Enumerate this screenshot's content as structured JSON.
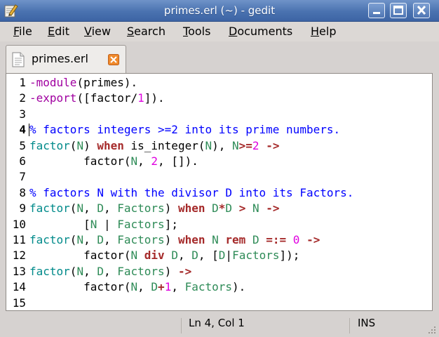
{
  "window": {
    "title": "primes.erl (~) - gedit",
    "app_icon": "gedit-pencil-icon",
    "buttons": [
      "minimize-icon",
      "maximize-icon",
      "close-icon"
    ]
  },
  "menubar": {
    "items": [
      {
        "label": "File",
        "mnemonic": "F",
        "rest": "ile"
      },
      {
        "label": "Edit",
        "mnemonic": "E",
        "rest": "dit"
      },
      {
        "label": "View",
        "mnemonic": "V",
        "rest": "iew"
      },
      {
        "label": "Search",
        "mnemonic": "S",
        "rest": "earch"
      },
      {
        "label": "Tools",
        "mnemonic": "T",
        "rest": "ools"
      },
      {
        "label": "Documents",
        "mnemonic": "D",
        "rest": "ocuments"
      },
      {
        "label": "Help",
        "mnemonic": "H",
        "rest": "elp"
      }
    ]
  },
  "tabs": [
    {
      "label": "primes.erl",
      "icon": "text-file-icon",
      "close_icon": "tab-close-icon"
    }
  ],
  "editor": {
    "current_line": 4,
    "lines": [
      {
        "n": "1",
        "tokens": [
          [
            "attr",
            "-module"
          ],
          [
            "plain",
            "(primes)."
          ]
        ]
      },
      {
        "n": "2",
        "tokens": [
          [
            "attr",
            "-export"
          ],
          [
            "plain",
            "([factor/"
          ],
          [
            "num",
            "1"
          ],
          [
            "plain",
            "])."
          ]
        ]
      },
      {
        "n": "3",
        "tokens": []
      },
      {
        "n": "4",
        "tokens": [
          [
            "cmt",
            "% factors integers >=2 into its prime numbers."
          ]
        ]
      },
      {
        "n": "5",
        "tokens": [
          [
            "func",
            "factor"
          ],
          [
            "plain",
            "("
          ],
          [
            "var",
            "N"
          ],
          [
            "plain",
            ") "
          ],
          [
            "kw",
            "when"
          ],
          [
            "plain",
            " is_integer("
          ],
          [
            "var",
            "N"
          ],
          [
            "plain",
            "), "
          ],
          [
            "var",
            "N"
          ],
          [
            "kw",
            ">="
          ],
          [
            "num",
            "2"
          ],
          [
            "plain",
            " "
          ],
          [
            "kw",
            "->"
          ]
        ]
      },
      {
        "n": "6",
        "tokens": [
          [
            "plain",
            "        factor("
          ],
          [
            "var",
            "N"
          ],
          [
            "plain",
            ", "
          ],
          [
            "num",
            "2"
          ],
          [
            "plain",
            ", [])."
          ]
        ]
      },
      {
        "n": "7",
        "tokens": []
      },
      {
        "n": "8",
        "tokens": [
          [
            "cmt",
            "% factors N with the divisor D into its Factors."
          ]
        ]
      },
      {
        "n": "9",
        "tokens": [
          [
            "func",
            "factor"
          ],
          [
            "plain",
            "("
          ],
          [
            "var",
            "N"
          ],
          [
            "plain",
            ", "
          ],
          [
            "var",
            "D"
          ],
          [
            "plain",
            ", "
          ],
          [
            "var",
            "Factors"
          ],
          [
            "plain",
            ") "
          ],
          [
            "kw",
            "when"
          ],
          [
            "plain",
            " "
          ],
          [
            "var",
            "D"
          ],
          [
            "kw",
            "*"
          ],
          [
            "var",
            "D"
          ],
          [
            "plain",
            " "
          ],
          [
            "kw",
            ">"
          ],
          [
            "plain",
            " "
          ],
          [
            "var",
            "N"
          ],
          [
            "plain",
            " "
          ],
          [
            "kw",
            "->"
          ]
        ]
      },
      {
        "n": "10",
        "tokens": [
          [
            "plain",
            "        ["
          ],
          [
            "var",
            "N"
          ],
          [
            "plain",
            " | "
          ],
          [
            "var",
            "Factors"
          ],
          [
            "plain",
            "];"
          ]
        ]
      },
      {
        "n": "11",
        "tokens": [
          [
            "func",
            "factor"
          ],
          [
            "plain",
            "("
          ],
          [
            "var",
            "N"
          ],
          [
            "plain",
            ", "
          ],
          [
            "var",
            "D"
          ],
          [
            "plain",
            ", "
          ],
          [
            "var",
            "Factors"
          ],
          [
            "plain",
            ") "
          ],
          [
            "kw",
            "when"
          ],
          [
            "plain",
            " "
          ],
          [
            "var",
            "N"
          ],
          [
            "plain",
            " "
          ],
          [
            "kw",
            "rem"
          ],
          [
            "plain",
            " "
          ],
          [
            "var",
            "D"
          ],
          [
            "plain",
            " "
          ],
          [
            "kw",
            "=:="
          ],
          [
            "plain",
            " "
          ],
          [
            "num",
            "0"
          ],
          [
            "plain",
            " "
          ],
          [
            "kw",
            "->"
          ]
        ]
      },
      {
        "n": "12",
        "tokens": [
          [
            "plain",
            "        factor("
          ],
          [
            "var",
            "N"
          ],
          [
            "plain",
            " "
          ],
          [
            "kw",
            "div"
          ],
          [
            "plain",
            " "
          ],
          [
            "var",
            "D"
          ],
          [
            "plain",
            ", "
          ],
          [
            "var",
            "D"
          ],
          [
            "plain",
            ", ["
          ],
          [
            "var",
            "D"
          ],
          [
            "plain",
            "|"
          ],
          [
            "var",
            "Factors"
          ],
          [
            "plain",
            "]);"
          ]
        ]
      },
      {
        "n": "13",
        "tokens": [
          [
            "func",
            "factor"
          ],
          [
            "plain",
            "("
          ],
          [
            "var",
            "N"
          ],
          [
            "plain",
            ", "
          ],
          [
            "var",
            "D"
          ],
          [
            "plain",
            ", "
          ],
          [
            "var",
            "Factors"
          ],
          [
            "plain",
            ") "
          ],
          [
            "kw",
            "->"
          ]
        ]
      },
      {
        "n": "14",
        "tokens": [
          [
            "plain",
            "        factor("
          ],
          [
            "var",
            "N"
          ],
          [
            "plain",
            ", "
          ],
          [
            "var",
            "D"
          ],
          [
            "kw",
            "+"
          ],
          [
            "num",
            "1"
          ],
          [
            "plain",
            ", "
          ],
          [
            "var",
            "Factors"
          ],
          [
            "plain",
            ")."
          ]
        ]
      },
      {
        "n": "15",
        "tokens": []
      }
    ]
  },
  "statusbar": {
    "position": "Ln 4, Col 1",
    "mode": "INS"
  }
}
